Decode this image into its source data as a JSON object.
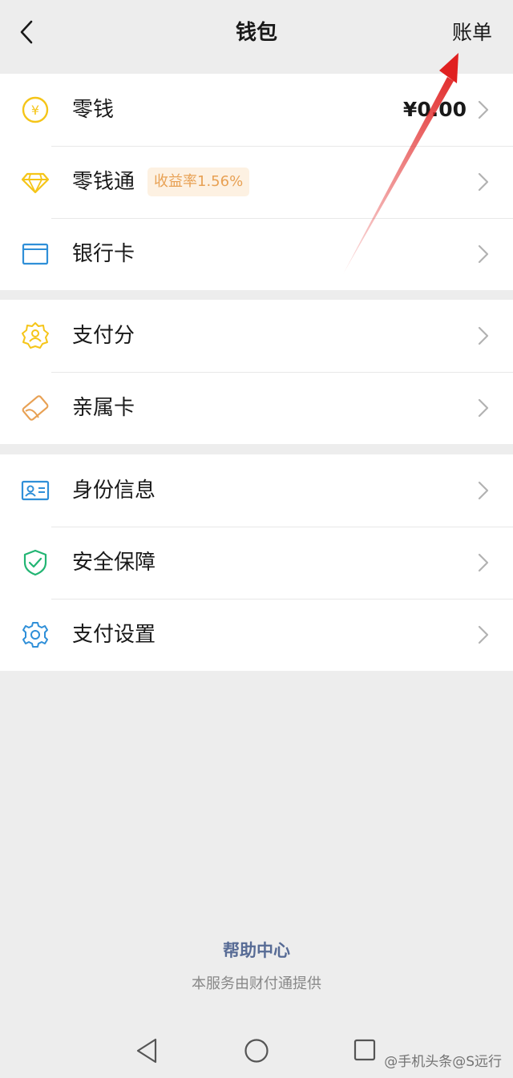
{
  "header": {
    "title": "钱包",
    "bill_label": "账单"
  },
  "group1": [
    {
      "label": "零钱",
      "value": "¥0.00",
      "icon": "yuan-coin-icon",
      "color": "#f5c518"
    },
    {
      "label": "零钱通",
      "badge": "收益率1.56%",
      "icon": "diamond-icon",
      "color": "#f5c518"
    },
    {
      "label": "银行卡",
      "icon": "bank-card-icon",
      "color": "#2f8fd8"
    }
  ],
  "group2": [
    {
      "label": "支付分",
      "icon": "score-badge-icon",
      "color": "#f5c518"
    },
    {
      "label": "亲属卡",
      "icon": "family-card-icon",
      "color": "#e8a154"
    }
  ],
  "group3": [
    {
      "label": "身份信息",
      "icon": "id-card-icon",
      "color": "#2f8fd8"
    },
    {
      "label": "安全保障",
      "icon": "shield-check-icon",
      "color": "#22b573"
    },
    {
      "label": "支付设置",
      "icon": "gear-icon",
      "color": "#2f8fd8"
    }
  ],
  "footer": {
    "help_label": "帮助中心",
    "provider_note": "本服务由财付通提供"
  },
  "watermark": "@手机头条@S远行",
  "colors": {
    "background": "#ededed",
    "link": "#576b95",
    "annotation_arrow": "#e02020"
  }
}
